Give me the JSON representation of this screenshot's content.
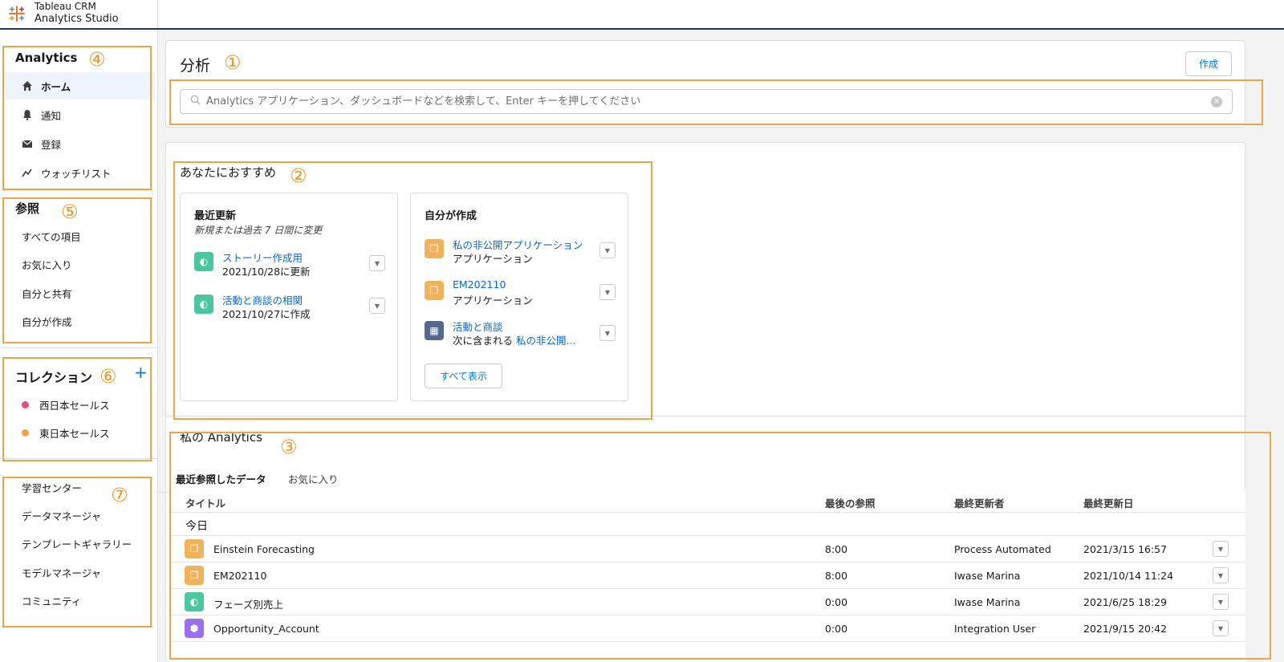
{
  "header": {
    "product_line1": "Tableau CRM",
    "product_line2": "Analytics Studio"
  },
  "sidebar": {
    "analytics": {
      "title": "Analytics",
      "items": [
        {
          "label": "ホーム",
          "icon": "home-icon"
        },
        {
          "label": "通知",
          "icon": "bell-icon"
        },
        {
          "label": "登録",
          "icon": "mail-icon"
        },
        {
          "label": "ウォッチリスト",
          "icon": "trend-icon"
        }
      ]
    },
    "browse": {
      "title": "参照",
      "items": [
        {
          "label": "すべての項目"
        },
        {
          "label": "お気に入り"
        },
        {
          "label": "自分と共有"
        },
        {
          "label": "自分が作成"
        }
      ]
    },
    "collections": {
      "title": "コレクション",
      "add_label": "+",
      "items": [
        {
          "label": "西日本セールス",
          "color": "#e3517a"
        },
        {
          "label": "東日本セールス",
          "color": "#f0a345"
        }
      ]
    },
    "resources": {
      "items": [
        {
          "label": "学習センター"
        },
        {
          "label": "データマネージャ"
        },
        {
          "label": "テンプレートギャラリー"
        },
        {
          "label": "モデルマネージャ"
        },
        {
          "label": "コミュニティ"
        }
      ]
    }
  },
  "annotations": [
    "①",
    "②",
    "③",
    "④",
    "⑤",
    "⑥",
    "⑦"
  ],
  "main": {
    "title": "分析",
    "create_label": "作成",
    "search_placeholder": "Analytics アプリケーション、ダッシュボードなどを検索して、Enter キーを押してください",
    "recommend": {
      "title": "あなたにおすすめ",
      "recent": {
        "title": "最近更新",
        "subtitle": "新規または過去 7 日間に変更",
        "items": [
          {
            "name": "ストーリー作成用",
            "sub": "2021/10/28に更新"
          },
          {
            "name": "活動と商談の相関",
            "sub": "2021/10/27に作成"
          }
        ]
      },
      "mine": {
        "title": "自分が作成",
        "items": [
          {
            "name": "私の非公開アプリケーション",
            "sub": "アプリケーション"
          },
          {
            "name": "EM202110",
            "sub": "アプリケーション"
          },
          {
            "name": "活動と商談",
            "sub_prefix": "次に含まれる",
            "sub_link": "私の非公開..."
          }
        ],
        "view_all_label": "すべて表示"
      }
    },
    "my_analytics": {
      "title": "私の Analytics",
      "tabs": [
        "最近参照したデータ",
        "お気に入り"
      ],
      "columns": [
        "タイトル",
        "最後の参照",
        "最終更新者",
        "最終更新日"
      ],
      "group_today": "今日",
      "rows": [
        {
          "title": "Einstein Forecasting",
          "viewed": "8:00",
          "updated_by": "Process Automated",
          "updated": "2021/3/15 16:57"
        },
        {
          "title": "EM202110",
          "viewed": "8:00",
          "updated_by": "Iwase Marina",
          "updated": "2021/10/14 11:24"
        },
        {
          "title": "フェーズ別売上",
          "viewed": "0:00",
          "updated_by": "Iwase Marina",
          "updated": "2021/6/25 18:29"
        },
        {
          "title": "Opportunity_Account",
          "viewed": "0:00",
          "updated_by": "Integration User",
          "updated": "2021/9/15 20:42"
        }
      ]
    }
  },
  "colors": {
    "accent": "#0176d3",
    "annotation": "#e8a64a",
    "header_border": "#1b3a5c"
  }
}
